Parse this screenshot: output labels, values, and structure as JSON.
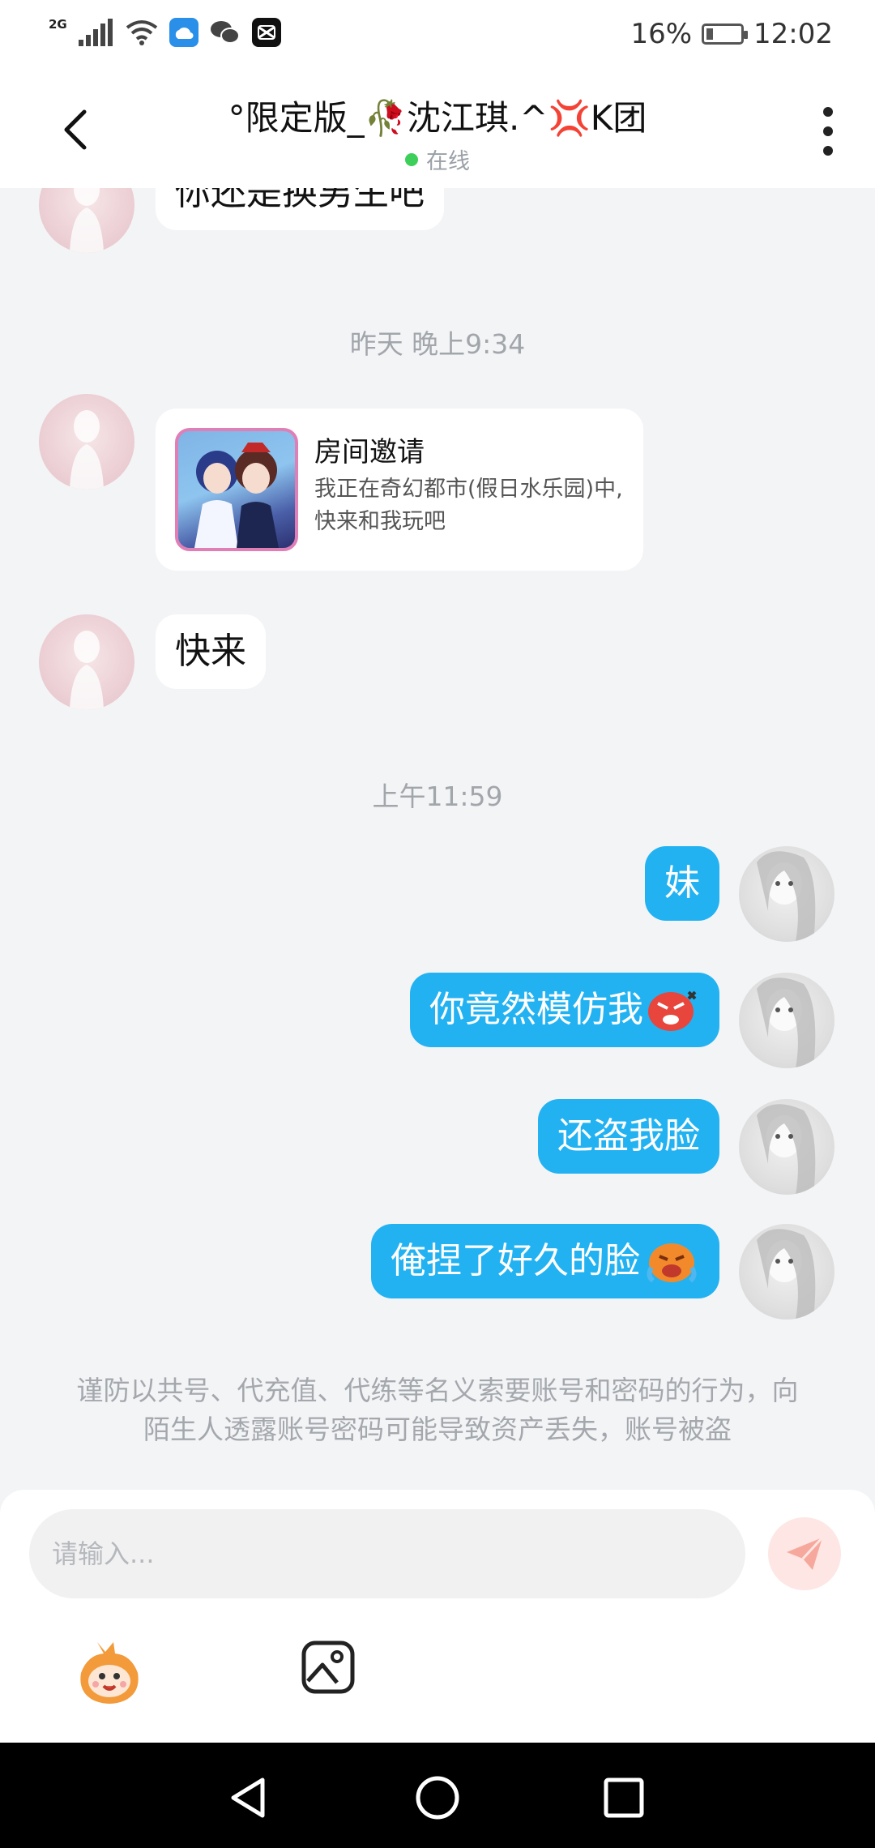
{
  "status_bar": {
    "network": "2G",
    "battery": "16%",
    "time": "12:02",
    "colors": {
      "weather_icon": "#2a8fe8",
      "capcut_icon": "#111111"
    }
  },
  "header": {
    "title": "°限定版_🥀沈江琪.^💢K团",
    "status": "在线",
    "icons": [
      "back-chevron-icon",
      "more-vertical-icon"
    ]
  },
  "chat": {
    "partial_message": "你还是换男生吧",
    "time_1": "昨天 晚上9:34",
    "invite_card": {
      "title": "房间邀请",
      "description": "我正在奇幻都市(假日水乐园)中, 快来和我玩吧"
    },
    "msg_come": "快来",
    "time_2": "上午11:59",
    "sent_messages": [
      {
        "text": "妹",
        "emoji": ""
      },
      {
        "text": "你竟然模仿我",
        "emoji": "angry-face-emoji"
      },
      {
        "text": "还盗我脸",
        "emoji": ""
      },
      {
        "text": "俺捏了好久的脸",
        "emoji": "crying-face-emoji"
      }
    ],
    "warning": "谨防以共号、代充值、代练等名义索要账号和密码的行为，向陌生人透露账号密码可能导致资产丢失，账号被盗"
  },
  "input": {
    "placeholder": "请输入...",
    "value": ""
  },
  "toolbar": {
    "icons": [
      "mascot-emoji-icon",
      "image-picker-icon",
      "send-plane-icon"
    ]
  },
  "colors": {
    "accent_bubble": "#22b2f2",
    "online_dot": "#3ecf5b",
    "send_button_bg": "#fde6e3",
    "send_icon": "#f7a89c",
    "background": "#f3f4f6"
  }
}
